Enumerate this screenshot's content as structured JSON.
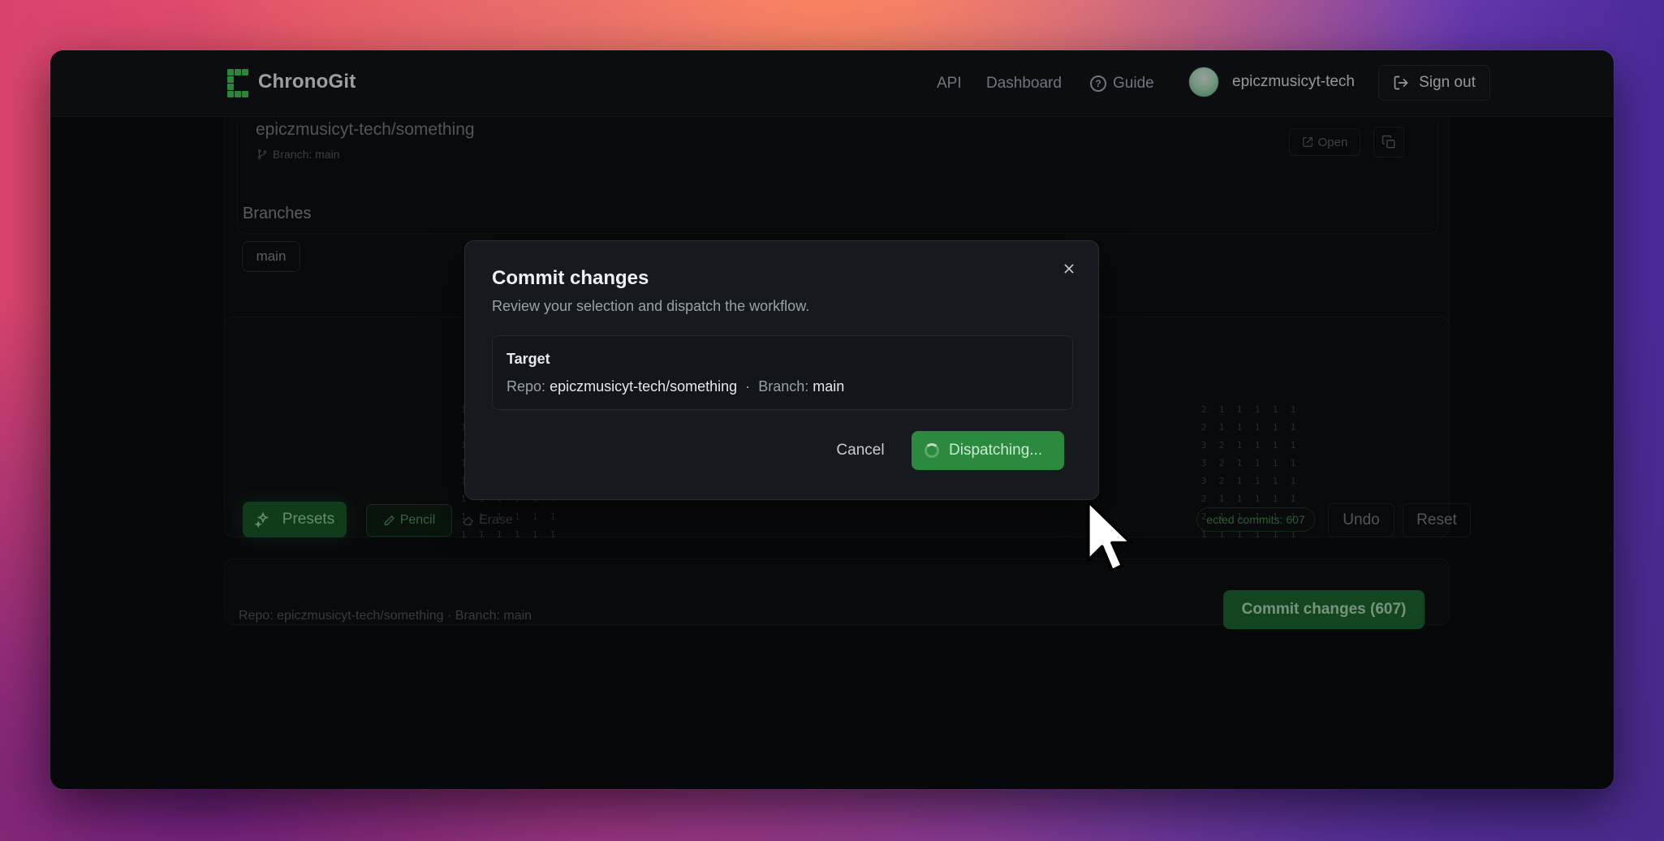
{
  "app": {
    "name": "ChronoGit",
    "brand_color": "#3fcf5d"
  },
  "nav": {
    "api": "API",
    "dashboard": "Dashboard",
    "guide": "Guide",
    "username": "epiczmusicyt-tech",
    "sign_out": "Sign out"
  },
  "repo": {
    "full_name": "epiczmusicyt-tech/something",
    "branch_line": "Branch: main",
    "open_label": "Open",
    "branches_title": "Branches",
    "branches": [
      "main"
    ]
  },
  "editor": {
    "left_grid": [
      "1",
      "1",
      "1",
      "1",
      "1",
      "1",
      "1",
      "1",
      "1",
      "1",
      "1",
      "1",
      "1",
      "1",
      "1",
      "1",
      "1",
      "1",
      "1",
      "1",
      "1",
      "1",
      "1",
      "1",
      "1",
      "1",
      "1",
      "1",
      "1",
      "1",
      "1",
      "1",
      "1",
      "1",
      "1",
      "1",
      "1",
      "1",
      "1",
      "1",
      "1",
      "1",
      "1",
      "1",
      "1",
      "1",
      "1",
      "1"
    ],
    "right_grid": [
      "2",
      "1",
      "1",
      "1",
      "1",
      "1",
      "2",
      "1",
      "1",
      "1",
      "1",
      "1",
      "3",
      "2",
      "1",
      "1",
      "1",
      "1",
      "3",
      "2",
      "1",
      "1",
      "1",
      "1",
      "3",
      "2",
      "1",
      "1",
      "1",
      "1",
      "2",
      "1",
      "1",
      "1",
      "1",
      "1",
      "2",
      "1",
      "1",
      "1",
      "1",
      "1",
      "1",
      "1",
      "1",
      "1",
      "1",
      "1"
    ],
    "presets_label": "Presets",
    "pencil_label": "Pencil",
    "erase_label": "Erase",
    "selected_commits": "ected commits: 607",
    "undo_label": "Undo",
    "reset_label": "Reset"
  },
  "footer": {
    "repo_line": "Repo: epiczmusicyt-tech/something · Branch: main",
    "commit_button": "Commit changes (607)"
  },
  "modal": {
    "title": "Commit changes",
    "description": "Review your selection and dispatch the workflow.",
    "target_label": "Target",
    "repo_prefix": "Repo:",
    "repo_value": "epiczmusicyt-tech/something",
    "separator": "·",
    "branch_prefix": "Branch:",
    "branch_value": "main",
    "cancel_label": "Cancel",
    "dispatch_label": "Dispatching..."
  }
}
